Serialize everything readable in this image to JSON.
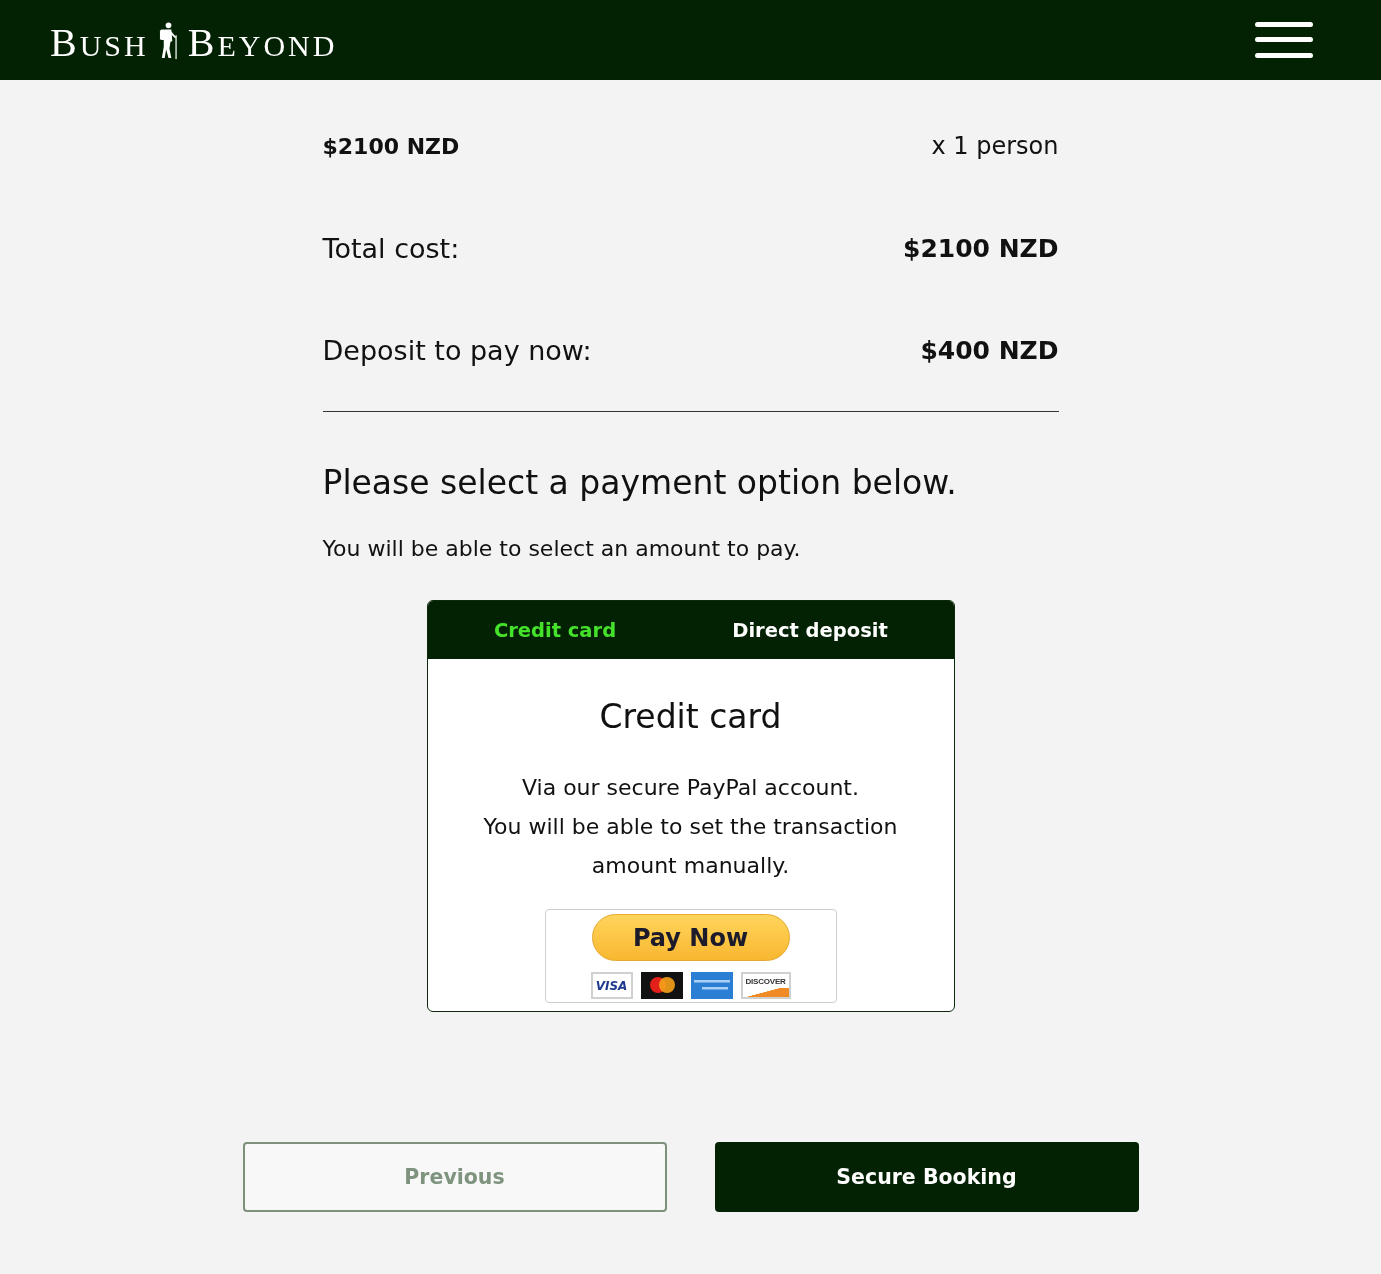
{
  "header": {
    "logo": {
      "word_1": "BUSH",
      "word_2": "BEYOND"
    }
  },
  "summary": {
    "rows": [
      {
        "kind": "price",
        "label": "$2100 NZD",
        "value": "x 1 person"
      },
      {
        "kind": "total",
        "label": "Total cost:",
        "value": "$2100 NZD"
      },
      {
        "kind": "total",
        "label": "Deposit to pay now:",
        "value": "$400 NZD"
      }
    ]
  },
  "payment": {
    "heading": "Please select a payment option below.",
    "note": "You will be able to select an amount to pay.",
    "tabs": [
      {
        "label": "Credit card",
        "selected": true
      },
      {
        "label": "Direct deposit",
        "selected": false
      }
    ],
    "panel": {
      "title": "Credit card",
      "lines": [
        "Via our secure PayPal account.",
        "You will be able to set the transaction amount manually."
      ],
      "paypal": {
        "button": "Pay Now",
        "cards": [
          {
            "kind": "visa",
            "label": "VISA"
          },
          {
            "kind": "mastercard"
          },
          {
            "kind": "amex"
          },
          {
            "kind": "discover",
            "label": "DISCOVER"
          }
        ]
      }
    }
  },
  "buttons": [
    {
      "kind": "secondary",
      "label": "Previous"
    },
    {
      "kind": "primary",
      "label": "Secure Booking"
    }
  ]
}
